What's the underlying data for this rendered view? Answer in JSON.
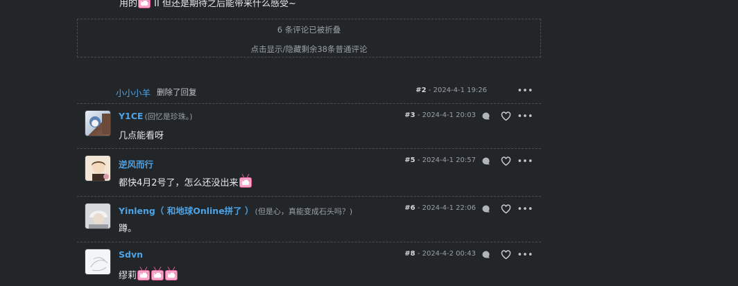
{
  "top_comment": {
    "text_before": "用的",
    "text_after": " II 但还是期待之后能带来什么感受~"
  },
  "collapsed": {
    "count_text": "6 条评论已被折叠",
    "toggle_text": "点击显示/隐藏剩余38条普通评论"
  },
  "deleted_reply": {
    "user": "小小小羊",
    "text": "删除了回复",
    "floor": "#2",
    "time": "- 2024-4-1 19:26"
  },
  "comments": [
    {
      "user": "Y1CE",
      "signature": "(回忆是珍珠。)",
      "text": "几点能看呀",
      "floor": "#3",
      "time": "- 2024-4-1 20:03"
    },
    {
      "user": "逆风而行",
      "signature": "",
      "text": "都快4月2号了，怎么还没出来",
      "floor": "#5",
      "time": "- 2024-4-1 20:57"
    },
    {
      "user": "Yinleng（ 和地球Online拼了 ）",
      "signature": "(但是心，真能变成石头吗？)",
      "text": "蹲。",
      "floor": "#6",
      "time": "- 2024-4-1 22:06"
    },
    {
      "user": "Sdvn",
      "signature": "",
      "text": "缪莉",
      "floor": "#8",
      "time": "- 2024-4-2 00:43"
    }
  ],
  "icons": {
    "reply": "speech-bubble-icon",
    "like": "heart-icon",
    "more": "more-dots-icon",
    "sticker": "tv-sticker-emoji"
  }
}
